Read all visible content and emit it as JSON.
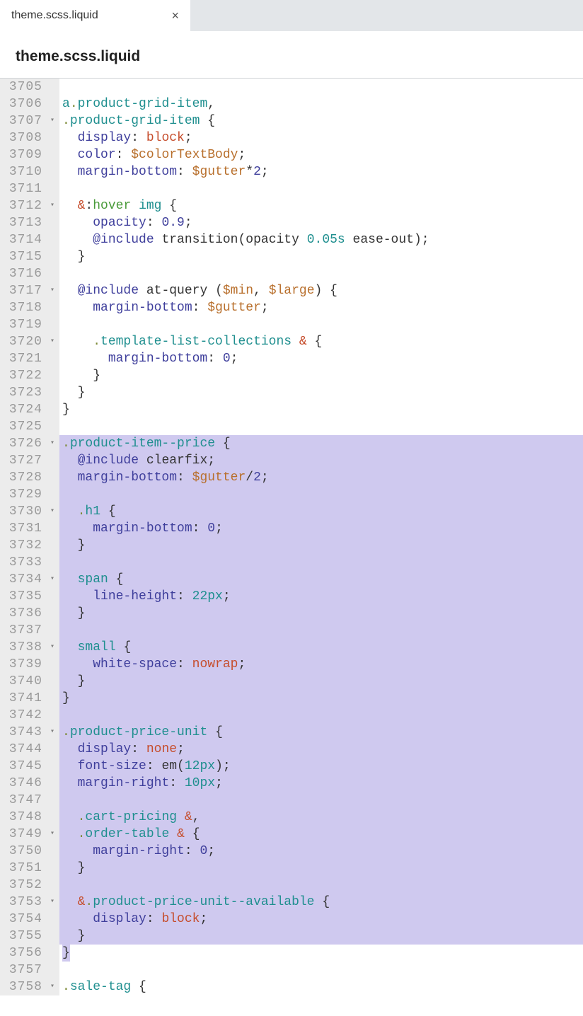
{
  "tab": {
    "label": "theme.scss.liquid",
    "close_glyph": "×"
  },
  "header": {
    "title": "theme.scss.liquid"
  },
  "gutter": {
    "start": 3705,
    "end": 3758,
    "fold_lines": [
      3707,
      3712,
      3717,
      3720,
      3726,
      3730,
      3734,
      3738,
      3743,
      3749,
      3753,
      3758
    ]
  },
  "fold_glyph": "▾",
  "selection": {
    "start": 3726,
    "end": 3756
  },
  "code": {
    "3705": [],
    "3706": [
      {
        "cls": "c-tag",
        "t": "a"
      },
      {
        "cls": "c-dot",
        "t": "."
      },
      {
        "cls": "c-tag",
        "t": "product-grid-item"
      },
      {
        "cls": "c-punc",
        "t": ","
      }
    ],
    "3707": [
      {
        "cls": "c-dot",
        "t": "."
      },
      {
        "cls": "c-tag",
        "t": "product-grid-item"
      },
      {
        "cls": "",
        "t": " "
      },
      {
        "cls": "c-brace",
        "t": "{"
      }
    ],
    "3708": [
      {
        "cls": "",
        "t": "  "
      },
      {
        "cls": "c-prop",
        "t": "display"
      },
      {
        "cls": "c-punc",
        "t": ": "
      },
      {
        "cls": "c-val",
        "t": "block"
      },
      {
        "cls": "c-punc",
        "t": ";"
      }
    ],
    "3709": [
      {
        "cls": "",
        "t": "  "
      },
      {
        "cls": "c-prop",
        "t": "color"
      },
      {
        "cls": "c-punc",
        "t": ": "
      },
      {
        "cls": "c-var",
        "t": "$colorTextBody"
      },
      {
        "cls": "c-punc",
        "t": ";"
      }
    ],
    "3710": [
      {
        "cls": "",
        "t": "  "
      },
      {
        "cls": "c-prop",
        "t": "margin-bottom"
      },
      {
        "cls": "c-punc",
        "t": ": "
      },
      {
        "cls": "c-var",
        "t": "$gutter"
      },
      {
        "cls": "c-punc",
        "t": "*"
      },
      {
        "cls": "c-num",
        "t": "2"
      },
      {
        "cls": "c-punc",
        "t": ";"
      }
    ],
    "3711": [],
    "3712": [
      {
        "cls": "",
        "t": "  "
      },
      {
        "cls": "c-amp",
        "t": "&"
      },
      {
        "cls": "c-punc",
        "t": ":"
      },
      {
        "cls": "c-pseudo",
        "t": "hover"
      },
      {
        "cls": "",
        "t": " "
      },
      {
        "cls": "c-tag",
        "t": "img"
      },
      {
        "cls": "",
        "t": " "
      },
      {
        "cls": "c-brace",
        "t": "{"
      }
    ],
    "3713": [
      {
        "cls": "",
        "t": "    "
      },
      {
        "cls": "c-prop",
        "t": "opacity"
      },
      {
        "cls": "c-punc",
        "t": ": "
      },
      {
        "cls": "c-num",
        "t": "0.9"
      },
      {
        "cls": "c-punc",
        "t": ";"
      }
    ],
    "3714": [
      {
        "cls": "",
        "t": "    "
      },
      {
        "cls": "c-incl",
        "t": "@include"
      },
      {
        "cls": "",
        "t": " "
      },
      {
        "cls": "c-func",
        "t": "transition"
      },
      {
        "cls": "c-paren",
        "t": "("
      },
      {
        "cls": "c-args",
        "t": "opacity "
      },
      {
        "cls": "c-time",
        "t": "0.05s"
      },
      {
        "cls": "c-args",
        "t": " ease-out"
      },
      {
        "cls": "c-paren",
        "t": ")"
      },
      {
        "cls": "c-punc",
        "t": ";"
      }
    ],
    "3715": [
      {
        "cls": "",
        "t": "  "
      },
      {
        "cls": "c-brace",
        "t": "}"
      }
    ],
    "3716": [],
    "3717": [
      {
        "cls": "",
        "t": "  "
      },
      {
        "cls": "c-incl",
        "t": "@include"
      },
      {
        "cls": "",
        "t": " "
      },
      {
        "cls": "c-func",
        "t": "at-query "
      },
      {
        "cls": "c-paren",
        "t": "("
      },
      {
        "cls": "c-var",
        "t": "$min"
      },
      {
        "cls": "c-punc",
        "t": ", "
      },
      {
        "cls": "c-var",
        "t": "$large"
      },
      {
        "cls": "c-paren",
        "t": ")"
      },
      {
        "cls": "",
        "t": " "
      },
      {
        "cls": "c-brace",
        "t": "{"
      }
    ],
    "3718": [
      {
        "cls": "",
        "t": "    "
      },
      {
        "cls": "c-prop",
        "t": "margin-bottom"
      },
      {
        "cls": "c-punc",
        "t": ": "
      },
      {
        "cls": "c-var",
        "t": "$gutter"
      },
      {
        "cls": "c-punc",
        "t": ";"
      }
    ],
    "3719": [],
    "3720": [
      {
        "cls": "",
        "t": "    "
      },
      {
        "cls": "c-dot",
        "t": "."
      },
      {
        "cls": "c-tag",
        "t": "template-list-collections"
      },
      {
        "cls": "",
        "t": " "
      },
      {
        "cls": "c-amp",
        "t": "&"
      },
      {
        "cls": "",
        "t": " "
      },
      {
        "cls": "c-brace",
        "t": "{"
      }
    ],
    "3721": [
      {
        "cls": "",
        "t": "      "
      },
      {
        "cls": "c-prop",
        "t": "margin-bottom"
      },
      {
        "cls": "c-punc",
        "t": ": "
      },
      {
        "cls": "c-num",
        "t": "0"
      },
      {
        "cls": "c-punc",
        "t": ";"
      }
    ],
    "3722": [
      {
        "cls": "",
        "t": "    "
      },
      {
        "cls": "c-brace",
        "t": "}"
      }
    ],
    "3723": [
      {
        "cls": "",
        "t": "  "
      },
      {
        "cls": "c-brace",
        "t": "}"
      }
    ],
    "3724": [
      {
        "cls": "c-brace",
        "t": "}"
      }
    ],
    "3725": [],
    "3726": [
      {
        "cls": "c-dot",
        "t": "."
      },
      {
        "cls": "c-tag",
        "t": "product-item--price"
      },
      {
        "cls": "",
        "t": " "
      },
      {
        "cls": "c-brace",
        "t": "{"
      }
    ],
    "3727": [
      {
        "cls": "",
        "t": "  "
      },
      {
        "cls": "c-incl",
        "t": "@include"
      },
      {
        "cls": "",
        "t": " "
      },
      {
        "cls": "c-func",
        "t": "clearfix"
      },
      {
        "cls": "c-punc",
        "t": ";"
      }
    ],
    "3728": [
      {
        "cls": "",
        "t": "  "
      },
      {
        "cls": "c-prop",
        "t": "margin-bottom"
      },
      {
        "cls": "c-punc",
        "t": ": "
      },
      {
        "cls": "c-var",
        "t": "$gutter"
      },
      {
        "cls": "c-punc",
        "t": "/"
      },
      {
        "cls": "c-num",
        "t": "2"
      },
      {
        "cls": "c-punc",
        "t": ";"
      }
    ],
    "3729": [],
    "3730": [
      {
        "cls": "",
        "t": "  "
      },
      {
        "cls": "c-dot",
        "t": "."
      },
      {
        "cls": "c-tag",
        "t": "h1"
      },
      {
        "cls": "",
        "t": " "
      },
      {
        "cls": "c-brace",
        "t": "{"
      }
    ],
    "3731": [
      {
        "cls": "",
        "t": "    "
      },
      {
        "cls": "c-prop",
        "t": "margin-bottom"
      },
      {
        "cls": "c-punc",
        "t": ": "
      },
      {
        "cls": "c-num",
        "t": "0"
      },
      {
        "cls": "c-punc",
        "t": ";"
      }
    ],
    "3732": [
      {
        "cls": "",
        "t": "  "
      },
      {
        "cls": "c-brace",
        "t": "}"
      }
    ],
    "3733": [],
    "3734": [
      {
        "cls": "",
        "t": "  "
      },
      {
        "cls": "c-tag",
        "t": "span"
      },
      {
        "cls": "",
        "t": " "
      },
      {
        "cls": "c-brace",
        "t": "{"
      }
    ],
    "3735": [
      {
        "cls": "",
        "t": "    "
      },
      {
        "cls": "c-prop",
        "t": "line-height"
      },
      {
        "cls": "c-punc",
        "t": ": "
      },
      {
        "cls": "c-time",
        "t": "22px"
      },
      {
        "cls": "c-punc",
        "t": ";"
      }
    ],
    "3736": [
      {
        "cls": "",
        "t": "  "
      },
      {
        "cls": "c-brace",
        "t": "}"
      }
    ],
    "3737": [],
    "3738": [
      {
        "cls": "",
        "t": "  "
      },
      {
        "cls": "c-tag",
        "t": "small"
      },
      {
        "cls": "",
        "t": " "
      },
      {
        "cls": "c-brace",
        "t": "{"
      }
    ],
    "3739": [
      {
        "cls": "",
        "t": "    "
      },
      {
        "cls": "c-prop",
        "t": "white-space"
      },
      {
        "cls": "c-punc",
        "t": ": "
      },
      {
        "cls": "c-val",
        "t": "nowrap"
      },
      {
        "cls": "c-punc",
        "t": ";"
      }
    ],
    "3740": [
      {
        "cls": "",
        "t": "  "
      },
      {
        "cls": "c-brace",
        "t": "}"
      }
    ],
    "3741": [
      {
        "cls": "c-brace",
        "t": "}"
      }
    ],
    "3742": [],
    "3743": [
      {
        "cls": "c-dot",
        "t": "."
      },
      {
        "cls": "c-tag",
        "t": "product-price-unit"
      },
      {
        "cls": "",
        "t": " "
      },
      {
        "cls": "c-brace",
        "t": "{"
      }
    ],
    "3744": [
      {
        "cls": "",
        "t": "  "
      },
      {
        "cls": "c-prop",
        "t": "display"
      },
      {
        "cls": "c-punc",
        "t": ": "
      },
      {
        "cls": "c-val",
        "t": "none"
      },
      {
        "cls": "c-punc",
        "t": ";"
      }
    ],
    "3745": [
      {
        "cls": "",
        "t": "  "
      },
      {
        "cls": "c-prop",
        "t": "font-size"
      },
      {
        "cls": "c-punc",
        "t": ": "
      },
      {
        "cls": "c-func",
        "t": "em"
      },
      {
        "cls": "c-paren",
        "t": "("
      },
      {
        "cls": "c-time",
        "t": "12px"
      },
      {
        "cls": "c-paren",
        "t": ")"
      },
      {
        "cls": "c-punc",
        "t": ";"
      }
    ],
    "3746": [
      {
        "cls": "",
        "t": "  "
      },
      {
        "cls": "c-prop",
        "t": "margin-right"
      },
      {
        "cls": "c-punc",
        "t": ": "
      },
      {
        "cls": "c-time",
        "t": "10px"
      },
      {
        "cls": "c-punc",
        "t": ";"
      }
    ],
    "3747": [],
    "3748": [
      {
        "cls": "",
        "t": "  "
      },
      {
        "cls": "c-dot",
        "t": "."
      },
      {
        "cls": "c-tag",
        "t": "cart-pricing"
      },
      {
        "cls": "",
        "t": " "
      },
      {
        "cls": "c-amp",
        "t": "&"
      },
      {
        "cls": "c-punc",
        "t": ","
      }
    ],
    "3749": [
      {
        "cls": "",
        "t": "  "
      },
      {
        "cls": "c-dot",
        "t": "."
      },
      {
        "cls": "c-tag",
        "t": "order-table"
      },
      {
        "cls": "",
        "t": " "
      },
      {
        "cls": "c-amp",
        "t": "&"
      },
      {
        "cls": "",
        "t": " "
      },
      {
        "cls": "c-brace",
        "t": "{"
      }
    ],
    "3750": [
      {
        "cls": "",
        "t": "    "
      },
      {
        "cls": "c-prop",
        "t": "margin-right"
      },
      {
        "cls": "c-punc",
        "t": ": "
      },
      {
        "cls": "c-num",
        "t": "0"
      },
      {
        "cls": "c-punc",
        "t": ";"
      }
    ],
    "3751": [
      {
        "cls": "",
        "t": "  "
      },
      {
        "cls": "c-brace",
        "t": "}"
      }
    ],
    "3752": [],
    "3753": [
      {
        "cls": "",
        "t": "  "
      },
      {
        "cls": "c-amp",
        "t": "&"
      },
      {
        "cls": "c-dot",
        "t": "."
      },
      {
        "cls": "c-tag",
        "t": "product-price-unit--available"
      },
      {
        "cls": "",
        "t": " "
      },
      {
        "cls": "c-brace",
        "t": "{"
      }
    ],
    "3754": [
      {
        "cls": "",
        "t": "    "
      },
      {
        "cls": "c-prop",
        "t": "display"
      },
      {
        "cls": "c-punc",
        "t": ": "
      },
      {
        "cls": "c-val",
        "t": "block"
      },
      {
        "cls": "c-punc",
        "t": ";"
      }
    ],
    "3755": [
      {
        "cls": "",
        "t": "  "
      },
      {
        "cls": "c-brace",
        "t": "}"
      }
    ],
    "3756": [
      {
        "cls": "c-brace",
        "t": "}"
      }
    ],
    "3757": [],
    "3758": [
      {
        "cls": "c-dot",
        "t": "."
      },
      {
        "cls": "c-tag",
        "t": "sale-tag"
      },
      {
        "cls": "",
        "t": " "
      },
      {
        "cls": "c-brace",
        "t": "{"
      }
    ]
  }
}
